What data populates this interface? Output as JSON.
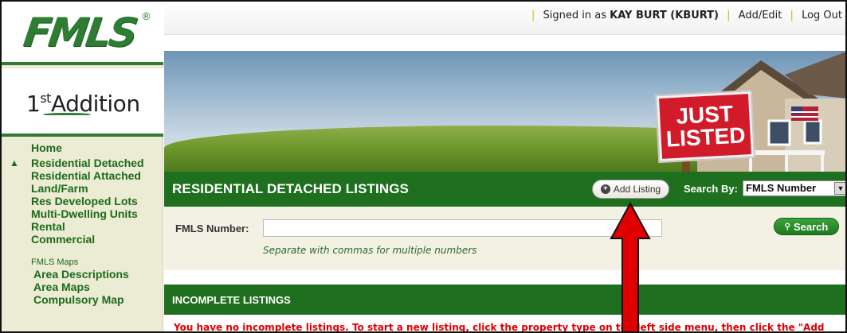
{
  "colors": {
    "brand_green": "#1e6f1e",
    "sidebar_bg": "#ecebd3",
    "alert_red": "#e10000",
    "arrow_red": "#e00000"
  },
  "sidebar": {
    "logo_text": "FMLS",
    "logo_mark": "®",
    "product_prefix": "1",
    "product_sup": "st",
    "product_suffix": "Addition",
    "nav": [
      {
        "label": "Home"
      },
      {
        "label": "Residential Detached",
        "icon": "home-icon"
      },
      {
        "label": "Residential Attached"
      },
      {
        "label": "Land/Farm"
      },
      {
        "label": "Res Developed Lots"
      },
      {
        "label": "Multi-Dwelling Units"
      },
      {
        "label": "Rental"
      },
      {
        "label": "Commercial"
      }
    ],
    "maps_title": "FMLS Maps",
    "maps": [
      {
        "label": "Area Descriptions"
      },
      {
        "label": "Area Maps"
      },
      {
        "label": "Compulsory Map"
      }
    ]
  },
  "topbar": {
    "signed_prefix": "Signed in as",
    "user": "KAY BURT (KBURT)",
    "add_edit": "Add/Edit",
    "logout": "Log Out"
  },
  "banner": {
    "sign_line1": "JUST",
    "sign_line2": "LISTED"
  },
  "main": {
    "title": "RESIDENTIAL DETACHED LISTINGS",
    "add_listing": "Add Listing",
    "search_by_label": "Search By:",
    "search_by_value": "FMLS Number",
    "fmls_label": "FMLS Number:",
    "fmls_value": "",
    "hint": "Separate with commas for multiple numbers",
    "search_button": "Search"
  },
  "incomplete": {
    "title": "INCOMPLETE LISTINGS",
    "message": "You have no incomplete listings. To start a new listing, click the property type on the left side menu, then click the \"Add"
  }
}
